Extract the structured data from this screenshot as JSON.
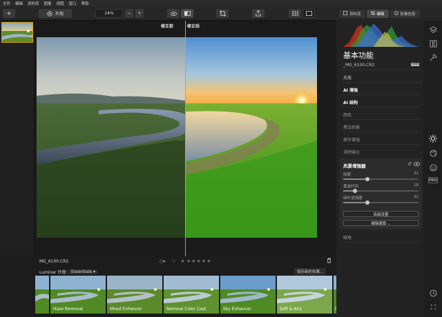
{
  "menu": [
    "文件",
    "编辑",
    "资料库",
    "图像",
    "视图",
    "窗口",
    "帮助"
  ],
  "toolbar": {
    "add_label": "+",
    "looks_label": "外观",
    "zoom_label": "24%",
    "zoom_minus": "−",
    "zoom_plus": "+"
  },
  "right_tabs": [
    {
      "label": "资料库"
    },
    {
      "label": "编辑"
    },
    {
      "label": "影像信息"
    }
  ],
  "canvas": {
    "before_label": "修正前",
    "after_label": "修正后"
  },
  "infobar": {
    "filename": "MG_6100.CR2",
    "stars": "★★★★★",
    "reject": "✕"
  },
  "presetbar": {
    "title": "Luminar 外观：",
    "category": "Essentials",
    "save_label": "保存新的效果..."
  },
  "presets": [
    {
      "name": ""
    },
    {
      "name": "Haze Removal"
    },
    {
      "name": "Mood Enhancer"
    },
    {
      "name": "Remove Color Cast"
    },
    {
      "name": "Sky Enhancer"
    },
    {
      "name": "Soft & Airy"
    },
    {
      "name": "S"
    }
  ],
  "panel": {
    "title": "基本功能",
    "filename": "_MG_6100.CR2",
    "raw_badge": "RAW",
    "sections": [
      {
        "label": "光效",
        "style": "normal"
      },
      {
        "label": "AI 增强",
        "style": "bold"
      },
      {
        "label": "AI 结构",
        "style": "bold"
      },
      {
        "label": "颜色",
        "style": "dim"
      },
      {
        "label": "黑白转换",
        "style": "dim"
      },
      {
        "label": "细节增强",
        "style": "dim"
      },
      {
        "label": "消除噪点",
        "style": "dim"
      }
    ],
    "landscape": {
      "title": "风景增强器",
      "sliders": [
        {
          "label": "除雾",
          "value": "32"
        },
        {
          "label": "黄金时间",
          "value": "16"
        },
        {
          "label": "绿叶增强器",
          "value": "32"
        }
      ],
      "advanced_label": "高级设置",
      "mask_label": "编辑蒙版 ⌄"
    },
    "vignette_label": "暗角"
  },
  "colors": {
    "accent": "#e0a000",
    "panel_bg": "#232323",
    "app_bg": "#1c1c1c"
  },
  "side_icons": [
    "layers-icon",
    "adjust-icon",
    "tools-icon",
    "sun-icon",
    "palette-icon",
    "face-icon",
    "pro-icon",
    "history-icon",
    "more-icon"
  ],
  "pro_label": "PRO"
}
